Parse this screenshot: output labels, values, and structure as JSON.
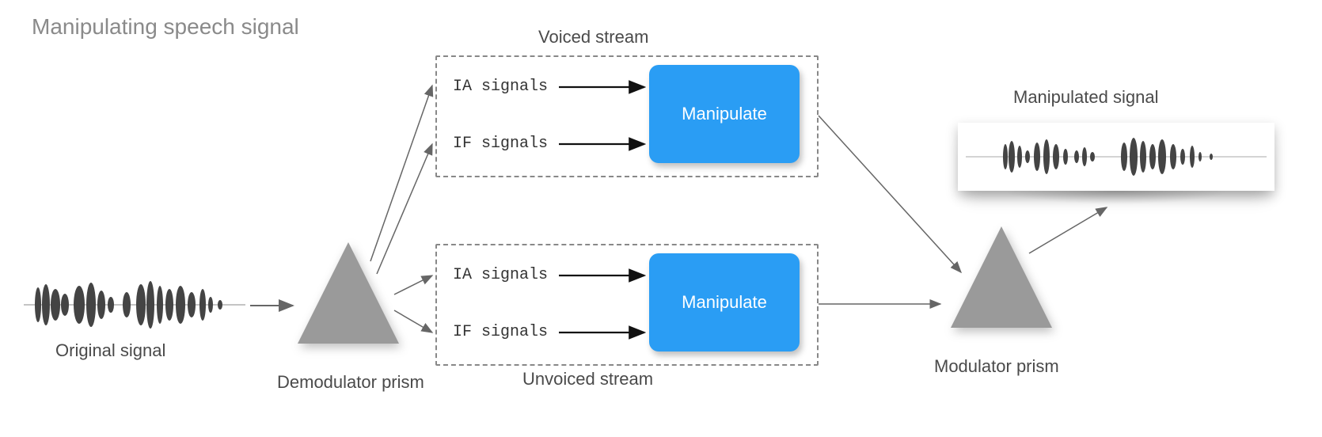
{
  "title": "Manipulating speech signal",
  "original_signal_label": "Original signal",
  "demodulator_label": "Demodulator prism",
  "modulator_label": "Modulator prism",
  "manipulated_label": "Manipulated signal",
  "voiced_stream": {
    "title": "Voiced stream",
    "ia_label": "IA signals",
    "if_label": "IF signals",
    "button": "Manipulate"
  },
  "unvoiced_stream": {
    "title": "Unvoiced stream",
    "ia_label": "IA signals",
    "if_label": "IF signals",
    "button": "Manipulate"
  },
  "colors": {
    "manipulate_bg": "#2a9df4",
    "prism_fill": "#9a9a9a",
    "arrow": "#666666",
    "waveform": "#444444"
  }
}
